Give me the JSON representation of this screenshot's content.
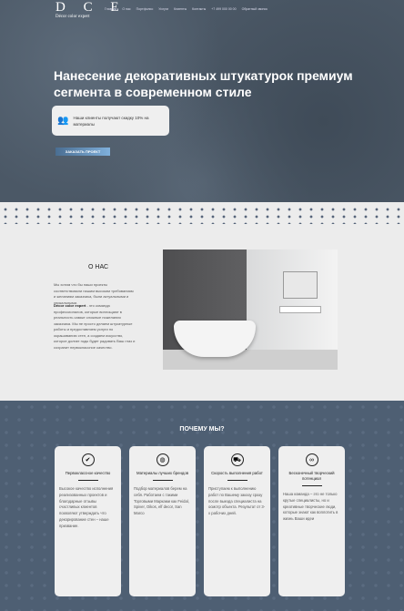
{
  "header": {
    "logo": "D C E",
    "logo_sub": "Décor color expert",
    "nav": [
      "Главная",
      "О нас",
      "Портфолио",
      "Услуги",
      "Клиенты",
      "Контакты",
      "+7 499 000 00 00",
      "Обратный звонок"
    ]
  },
  "hero": {
    "title": "Нанесение декоративных штукатурок премиум сегмента в современном стиле",
    "promo": "Наши клиенты получают скидку 10% на материалы",
    "cta": "ЗАКАЗАТЬ ПРОЕКТ"
  },
  "about": {
    "title": "О НАС",
    "p1": "Мы хотим что бы наши проекты соответствовали нашим высоким требованиям и желаниям заказчика, были актуальными и уникальными.",
    "brand": "Décor color expert",
    "p2": " - это команда профессионалов, которые воплощают в реальность самые сложные пожелания заказчика. Мы не просто делаем штукатурные работы и предоставляем услуги по окрашиванию стен, а создаем искусство, которое долгие годы будет радовать Ваш глаз и сохранит первоклассное качество."
  },
  "why": {
    "title": "ПОЧЕМУ МЫ?",
    "cards": [
      {
        "icon": "check-icon",
        "glyph": "✔",
        "title": "Первоклассное качество",
        "text": "Высокое качество исполнения реализованных проектов и благодарные отзывы счастливых клиентов позволяют утверждать что декорирование стен – наше призвание."
      },
      {
        "icon": "globe-icon",
        "glyph": "◍",
        "title": "Материалы лучших брендов",
        "text": "Подбор материалов берем на себя. Работаем с такими Торговыми Марками как Feidal, Spiver, Oikos, elf decor, San Marco"
      },
      {
        "icon": "truck-icon",
        "glyph": "⛟",
        "title": "Скорость выполнения работ",
        "text": "Приступаем к выполнению работ по Вашему заказу сразу после выезда специалиста на осмотр объекта. Результат от 3-х рабочих дней."
      },
      {
        "icon": "infinity-icon",
        "glyph": "∞",
        "title": "Бесконечный творческий потенциал",
        "text": "Наша команда – это не только крутые специалисты, но и креативные творческие люди, которые знают как воплотить в жизнь Ваши идеи"
      }
    ]
  }
}
